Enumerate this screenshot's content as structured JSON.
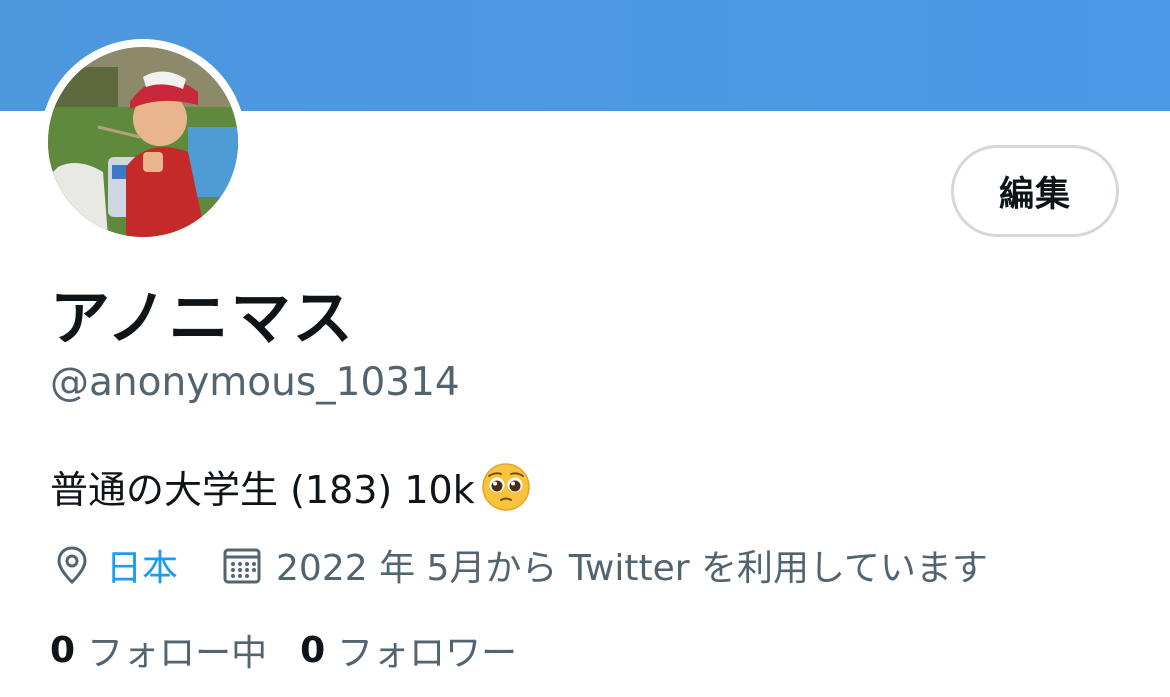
{
  "profile": {
    "edit_label": "編集",
    "display_name": "アノニマス",
    "handle": "@anonymous_10314",
    "bio": "普通の大学生 (183) 10k",
    "bio_emoji": "pleading-face-emoji",
    "location": "日本",
    "joined": "2022 年 5月から Twitter を利用しています",
    "following_count": "0",
    "following_label": "フォロー中",
    "followers_count": "0",
    "followers_label": "フォロワー"
  },
  "icons": {
    "location": "location-pin-icon",
    "joined": "calendar-icon"
  },
  "colors": {
    "banner": "#4a98e6",
    "link": "#1d9bf0",
    "secondary_text": "#536471",
    "primary_text": "#0f1419"
  }
}
